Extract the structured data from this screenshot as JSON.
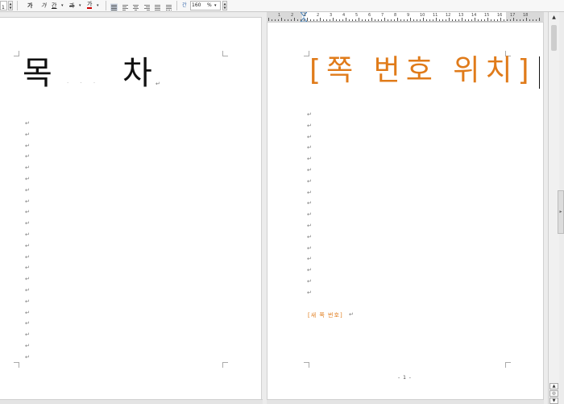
{
  "toolbar": {
    "font_size_value": "1",
    "bold_label": "가",
    "italic_label": "가",
    "underline_label": "간",
    "strike_label": "과",
    "font_color_label": "가",
    "line_spacing_label": "간",
    "line_spacing_value": "160",
    "line_spacing_unit": "%",
    "dropdown_arrow": "▾",
    "spin_up": "▲",
    "spin_down": "▼",
    "font_color": "#cc0000"
  },
  "ruler": {
    "labels": [
      "1",
      "2",
      "1",
      "2",
      "3",
      "4",
      "5",
      "6",
      "7",
      "8",
      "9",
      "10",
      "11",
      "12",
      "13",
      "14",
      "15",
      "16",
      "17",
      "18"
    ]
  },
  "left_page": {
    "title_first": "목",
    "title_second": "차",
    "title_dots": "· · ·",
    "paragraph_mark": "↵"
  },
  "right_page": {
    "title": "[쪽 번호 위치]",
    "field_text": "[새 쪽 번호]",
    "paragraph_mark": "↵",
    "page_number": "- 1 -",
    "accent_color": "#e07b1a"
  },
  "scrollbar": {
    "up_arrow": "▲",
    "down_arrow": "▼",
    "prev_page_icon": "▲",
    "page_select_icon": "◎",
    "next_page_icon": "▼",
    "splitter_arrow": "▸"
  }
}
